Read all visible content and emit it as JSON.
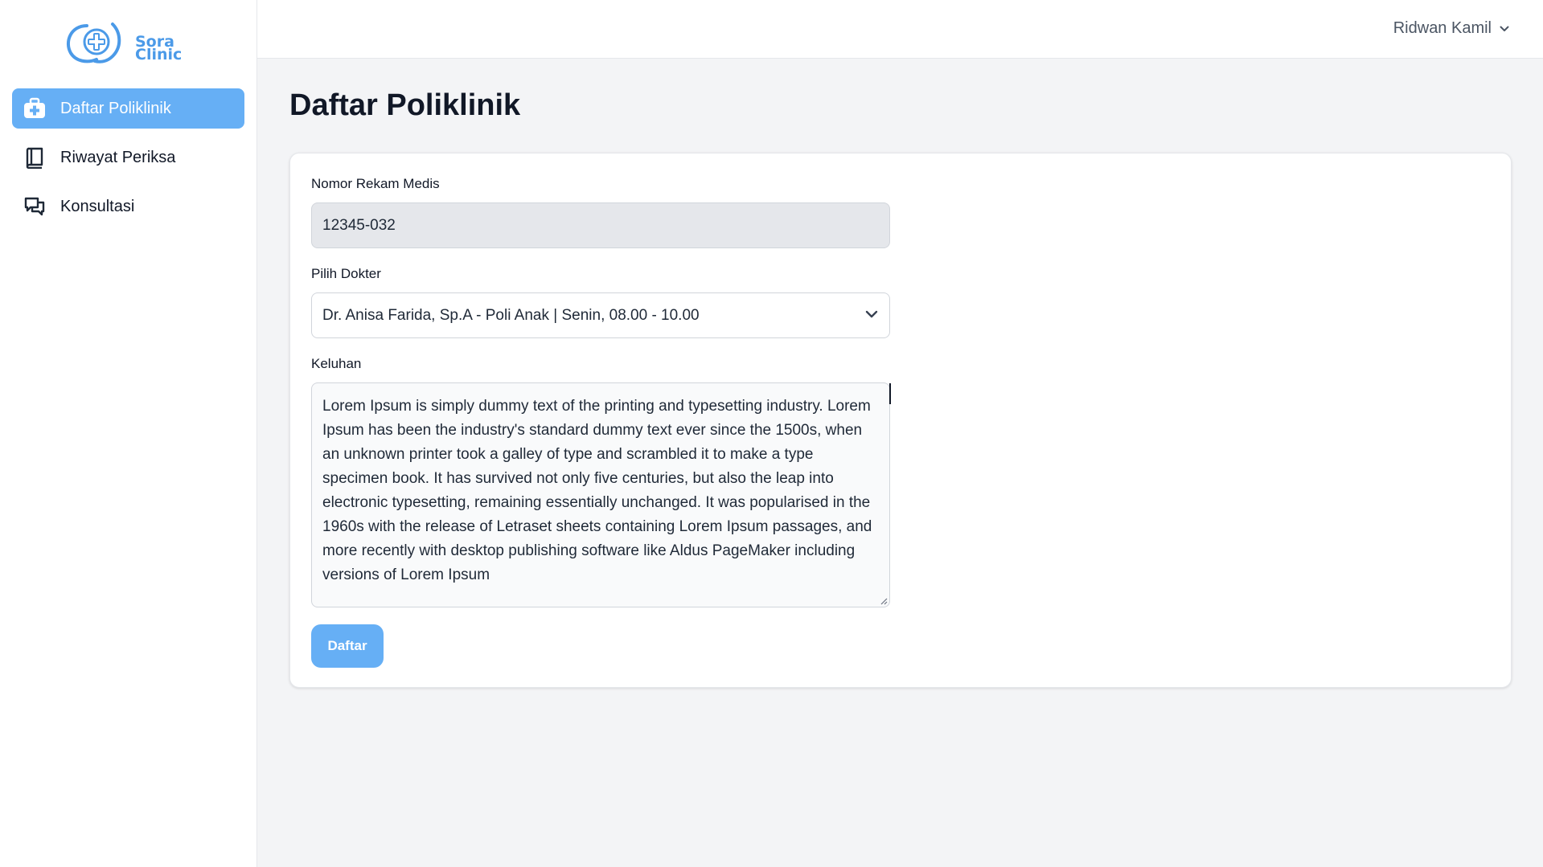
{
  "brand": {
    "name_line1": "Sora",
    "name_line2": "Clinic",
    "logo_icon": "medical-cross-logo-icon",
    "color": "#4b9ae8"
  },
  "sidebar": {
    "items": [
      {
        "label": "Daftar Poliklinik",
        "icon": "medical-kit-icon",
        "active": true
      },
      {
        "label": "Riwayat Periksa",
        "icon": "book-icon",
        "active": false
      },
      {
        "label": "Konsultasi",
        "icon": "chat-bubbles-icon",
        "active": false
      }
    ]
  },
  "header": {
    "user_name": "Ridwan Kamil",
    "user_menu_icon": "chevron-down-icon"
  },
  "main": {
    "title": "Daftar Poliklinik",
    "form": {
      "medical_record_label": "Nomor Rekam Medis",
      "medical_record_value": "12345-032",
      "doctor_label": "Pilih Dokter",
      "doctor_value": "Dr. Anisa Farida, Sp.A - Poli Anak | Senin, 08.00 - 10.00",
      "complaint_label": "Keluhan",
      "complaint_value": "Lorem Ipsum is simply dummy text of the printing and typesetting industry. Lorem Ipsum has been the industry's standard dummy text ever since the 1500s, when an unknown printer took a galley of type and scrambled it to make a type specimen book. It has survived not only five centuries, but also the leap into electronic typesetting, remaining essentially unchanged. It was popularised in the 1960s with the release of Letraset sheets containing Lorem Ipsum passages, and more recently with desktop publishing software like Aldus PageMaker including versions of Lorem Ipsum",
      "submit_label": "Daftar"
    }
  },
  "colors": {
    "accent": "#66aff5",
    "background": "#f3f4f6",
    "readonly_field": "#e5e7eb"
  }
}
